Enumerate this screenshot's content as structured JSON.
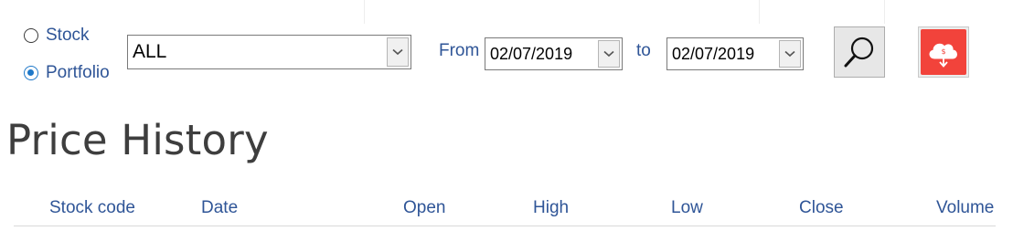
{
  "filter": {
    "radio_options": [
      {
        "label": "Stock",
        "checked": false
      },
      {
        "label": "Portfolio",
        "checked": true
      }
    ],
    "selector": {
      "value": "ALL"
    },
    "from_label": "From",
    "from_date": "02/07/2019",
    "to_label": "to",
    "to_date": "02/07/2019"
  },
  "toolbar": {
    "search_icon": "search-icon",
    "download_icon": "cloud-download-icon",
    "download_icon_glyph": "$",
    "download_color": "#f2433b"
  },
  "page": {
    "title": "Price History"
  },
  "table": {
    "columns": [
      "Stock code",
      "Date",
      "Open",
      "High",
      "Low",
      "Close",
      "Volume"
    ],
    "rows": []
  },
  "colors": {
    "accent_text": "#2f5597",
    "radio_selected": "#1e78c8"
  }
}
